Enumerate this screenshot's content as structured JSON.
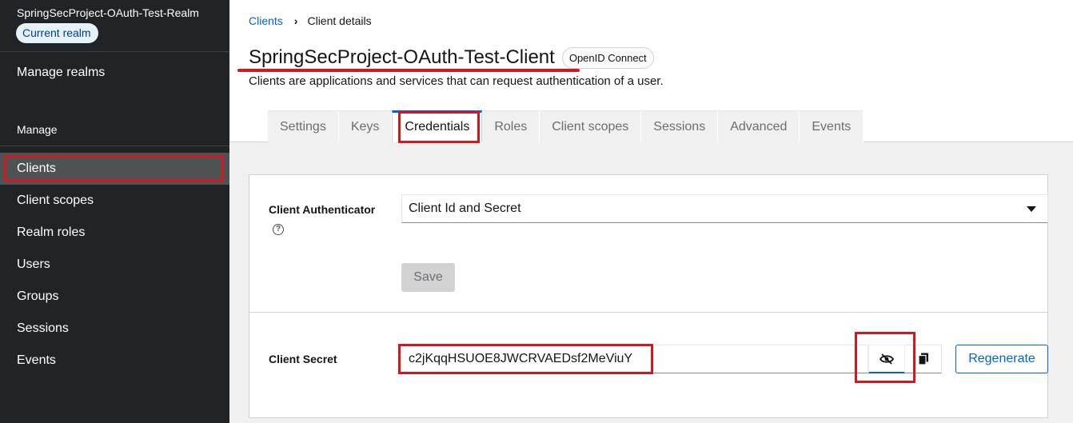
{
  "sidebar": {
    "realm_name": "SpringSecProject-OAuth-Test-Realm",
    "realm_badge": "Current realm",
    "manage_realms": "Manage realms",
    "section_label": "Manage",
    "items": [
      {
        "label": "Clients",
        "active": true
      },
      {
        "label": "Client scopes"
      },
      {
        "label": "Realm roles"
      },
      {
        "label": "Users"
      },
      {
        "label": "Groups"
      },
      {
        "label": "Sessions"
      },
      {
        "label": "Events"
      }
    ]
  },
  "breadcrumb": {
    "parent": "Clients",
    "current": "Client details"
  },
  "header": {
    "title": "SpringSecProject-OAuth-Test-Client",
    "protocol_badge": "OpenID Connect",
    "subtitle": "Clients are applications and services that can request authentication of a user."
  },
  "tabs": [
    {
      "label": "Settings"
    },
    {
      "label": "Keys"
    },
    {
      "label": "Credentials",
      "active": true
    },
    {
      "label": "Roles"
    },
    {
      "label": "Client scopes"
    },
    {
      "label": "Sessions"
    },
    {
      "label": "Advanced"
    },
    {
      "label": "Events"
    }
  ],
  "credentials": {
    "authenticator_label": "Client Authenticator",
    "authenticator_value": "Client Id and Secret",
    "save_label": "Save",
    "secret_label": "Client Secret",
    "secret_value": "c2jKqqHSUOE8JWCRVAEDsf2MeViuY",
    "regenerate_label": "Regenerate"
  },
  "icons": {
    "help": "question-circle-icon",
    "dropdown": "caret-down-icon",
    "visibility": "eye-slash-icon",
    "copy": "copy-icon"
  },
  "colors": {
    "sidebar_bg": "#212427",
    "sidebar_active": "#4f5255",
    "accent": "#0066cc",
    "annotation_red": "#d01820"
  }
}
